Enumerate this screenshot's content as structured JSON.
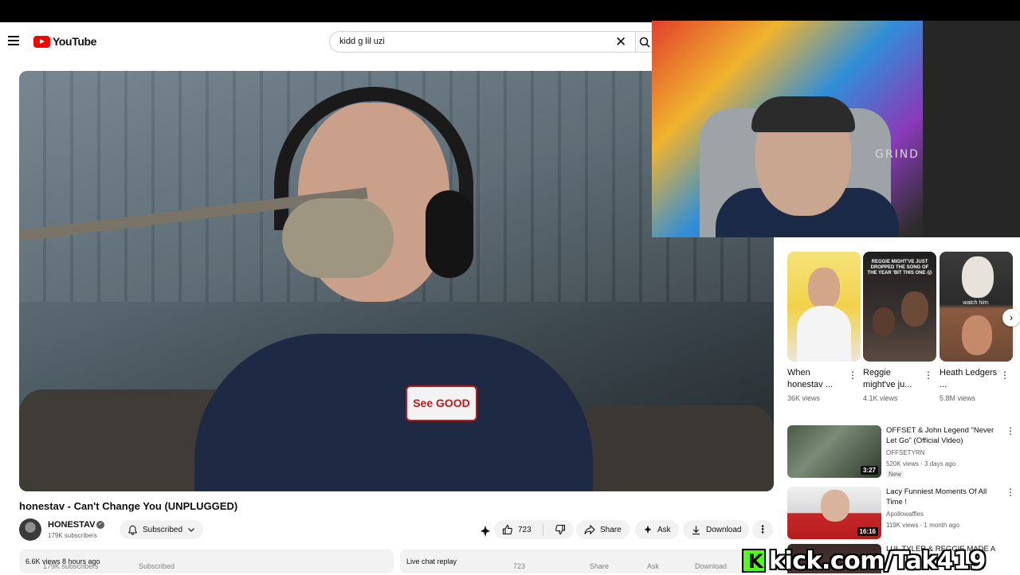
{
  "header": {
    "logo_text": "YouTube",
    "search_value": "kidd g lil uzi",
    "clear_glyph": "✕"
  },
  "video": {
    "title": "honestav - Can't Change You (UNPLUGGED)",
    "name_tag": "See GOOD",
    "channel_name": "HONESTAV",
    "subscribers": "179K subscribers",
    "subscribed_label": "Subscribed",
    "likes": "723",
    "share_label": "Share",
    "ask_label": "Ask",
    "download_label": "Download",
    "more_glyph": "⋮",
    "views_time": "6.6K views  8 hours ago",
    "live_chat": "Live chat replay"
  },
  "webcam": {
    "poster_text": "GRIND"
  },
  "shorts": [
    {
      "title": "When honestav ...",
      "views": "36K views",
      "thumb_caption": ""
    },
    {
      "title": "Reggie might've ju...",
      "views": "4.1K views",
      "thumb_caption": "REGGIE MIGHT'VE JUST DROPPED THE SONG OF THE YEAR 'BIT THIS ONE 😱"
    },
    {
      "title": "Heath Ledgers ...",
      "views": "5.8M views",
      "thumb_caption": "watch him."
    }
  ],
  "recommendations": [
    {
      "title": "OFFSET & John Legend \"Never Let Go\" (Official Video)",
      "channel": "OFFSETYRN",
      "meta": "520K views · 3 days ago",
      "badge": "New",
      "duration": "3:27"
    },
    {
      "title": "Lacy Funniest Moments Of All Time !",
      "channel": "Apollowaffles",
      "meta": "119K views · 1 month ago",
      "badge": "",
      "duration": "16:16"
    },
    {
      "title": "LUL TYLER & REGGIE MADE A",
      "channel": "",
      "meta": "",
      "badge": "",
      "duration": ""
    }
  ],
  "overlay": {
    "kick_letter": "K",
    "kick_text": "kick.com/Tak419"
  },
  "ghost_row": {
    "subscribers": "179K subscribers",
    "subscribed": "Subscribed",
    "likes": "723",
    "share": "Share",
    "ask": "Ask",
    "download": "Download"
  }
}
